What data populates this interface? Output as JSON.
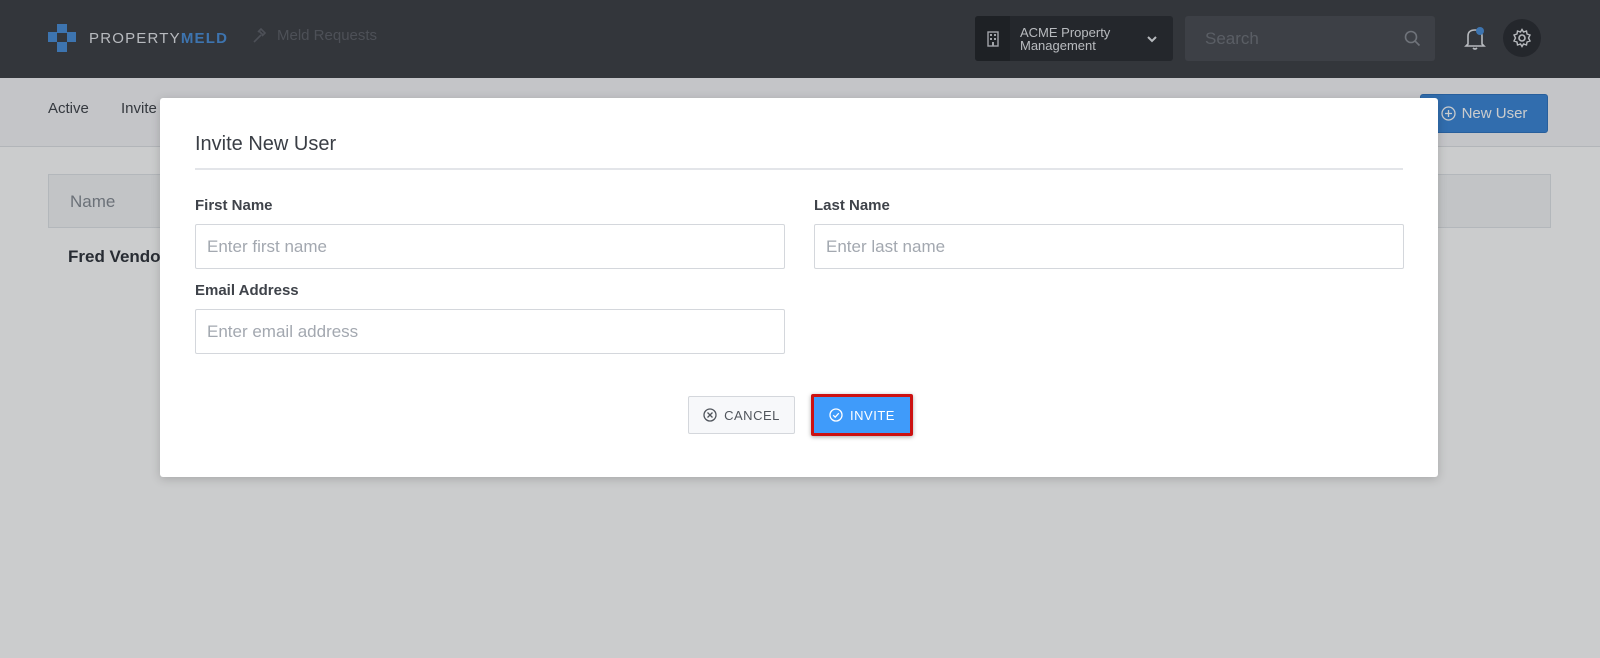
{
  "header": {
    "logo_text_light": "PROPERTY",
    "logo_text_bold": "MELD",
    "nav_melds_label": "Meld Requests",
    "org_name": "ACME Property Management",
    "search_placeholder": "Search"
  },
  "page": {
    "tabs": [
      "Active",
      "Invite"
    ],
    "new_user_label": "New User",
    "table_header_name": "Name",
    "rows": [
      "Fred Vendo"
    ]
  },
  "modal": {
    "title": "Invite New User",
    "first_name": {
      "label": "First Name",
      "placeholder": "Enter first name",
      "value": ""
    },
    "last_name": {
      "label": "Last Name",
      "placeholder": "Enter last name",
      "value": ""
    },
    "email": {
      "label": "Email Address",
      "placeholder": "Enter email address",
      "value": ""
    },
    "cancel_label": "CANCEL",
    "invite_label": "INVITE"
  },
  "colors": {
    "topbar": "#3d3f45",
    "brand_blue": "#4a8fd9",
    "primary_button": "#3f9bfa",
    "highlight": "#cc1111"
  },
  "icons": [
    "logo-icon",
    "hammer-icon",
    "building-icon",
    "chevron-down-icon",
    "search-icon",
    "bell-icon",
    "gear-icon",
    "plus-circle-icon",
    "x-circle-icon",
    "check-circle-icon"
  ]
}
